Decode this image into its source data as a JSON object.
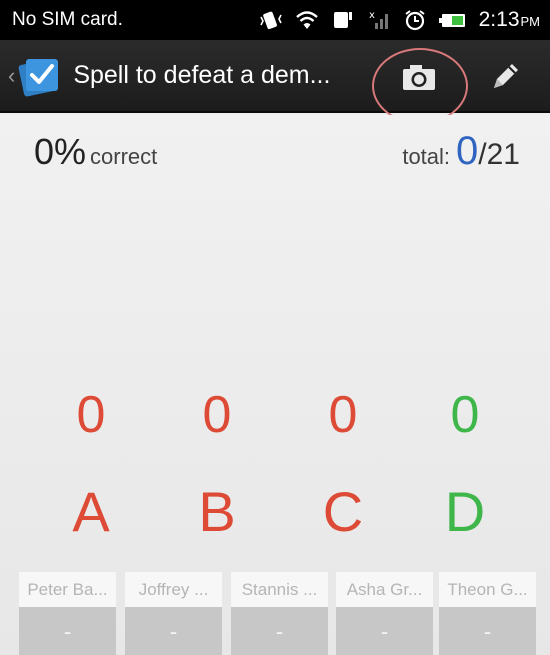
{
  "status_bar": {
    "carrier": "No SIM card.",
    "time": "2:13",
    "ampm": "PM"
  },
  "action_bar": {
    "back_chevron": "‹",
    "title": "Spell to defeat a dem...",
    "camera_icon": "camera-icon",
    "edit_icon": "pencil-icon"
  },
  "summary": {
    "percent": "0%",
    "correct_label": "correct",
    "total_label": "total:",
    "total_count": "0",
    "total_sep": "/",
    "total_max": "21"
  },
  "answers": [
    {
      "count": "0",
      "letter": "A",
      "color": "#dd4a35"
    },
    {
      "count": "0",
      "letter": "B",
      "color": "#dd4a35"
    },
    {
      "count": "0",
      "letter": "C",
      "color": "#dd4a35"
    },
    {
      "count": "0",
      "letter": "D",
      "color": "#3fb64a"
    }
  ],
  "students": [
    {
      "name": "Peter Ba...",
      "score": "-"
    },
    {
      "name": "Joffrey ...",
      "score": "-"
    },
    {
      "name": "Stannis ...",
      "score": "-"
    },
    {
      "name": "Asha Gr...",
      "score": "-"
    },
    {
      "name": "Theon G...",
      "score": "-"
    }
  ]
}
